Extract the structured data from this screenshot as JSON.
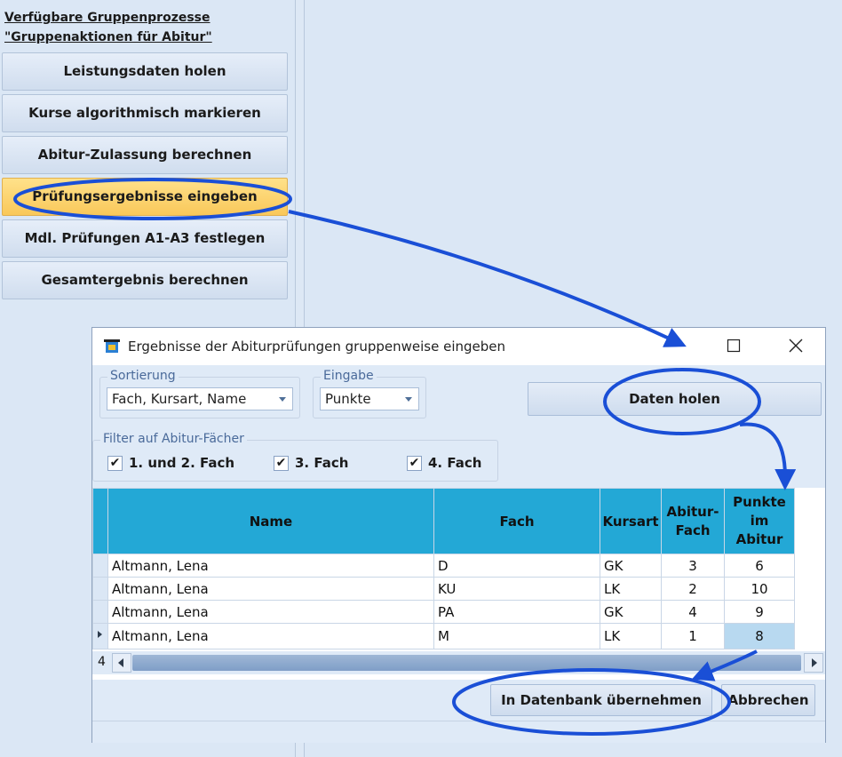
{
  "panel": {
    "title_line1": "Verfügbare Gruppenprozesse",
    "title_line2": "\"Gruppenaktionen für Abitur\"",
    "buttons": [
      "Leistungsdaten holen",
      "Kurse algorithmisch markieren",
      "Abitur-Zulassung berechnen",
      "Prüfungsergebnisse eingeben",
      "Mdl. Prüfungen A1-A3 festlegen",
      "Gesamtergebnis berechnen"
    ],
    "active_index": 3
  },
  "dialog": {
    "title": "Ergebnisse der Abiturprüfungen gruppenweise eingeben",
    "sort": {
      "label": "Sortierung",
      "value": "Fach, Kursart, Name"
    },
    "input": {
      "label": "Eingabe",
      "value": "Punkte"
    },
    "fetch_button": "Daten holen",
    "filter": {
      "label": "Filter auf Abitur-Fächer",
      "options": [
        "1. und 2. Fach",
        "3. Fach",
        "4. Fach"
      ],
      "checked": [
        true,
        true,
        true
      ],
      "check_glyph": "✔"
    },
    "table": {
      "columns": [
        "Name",
        "Fach",
        "Kursart",
        "Abitur-Fach",
        "Punkte im Abitur"
      ],
      "rows": [
        [
          "Altmann, Lena",
          "D",
          "GK",
          "3",
          "6"
        ],
        [
          "Altmann, Lena",
          "KU",
          "LK",
          "2",
          "10"
        ],
        [
          "Altmann, Lena",
          "PA",
          "GK",
          "4",
          "9"
        ],
        [
          "Altmann, Lena",
          "M",
          "LK",
          "1",
          "8"
        ]
      ],
      "selected_row": 3,
      "row_count": "4"
    },
    "save_button": "In Datenbank übernehmen",
    "cancel_button": "Abbrechen"
  },
  "colors": {
    "highlight": "#1a4fd6",
    "active_button": "#f9c85a",
    "grid_header": "#23a8d6"
  }
}
